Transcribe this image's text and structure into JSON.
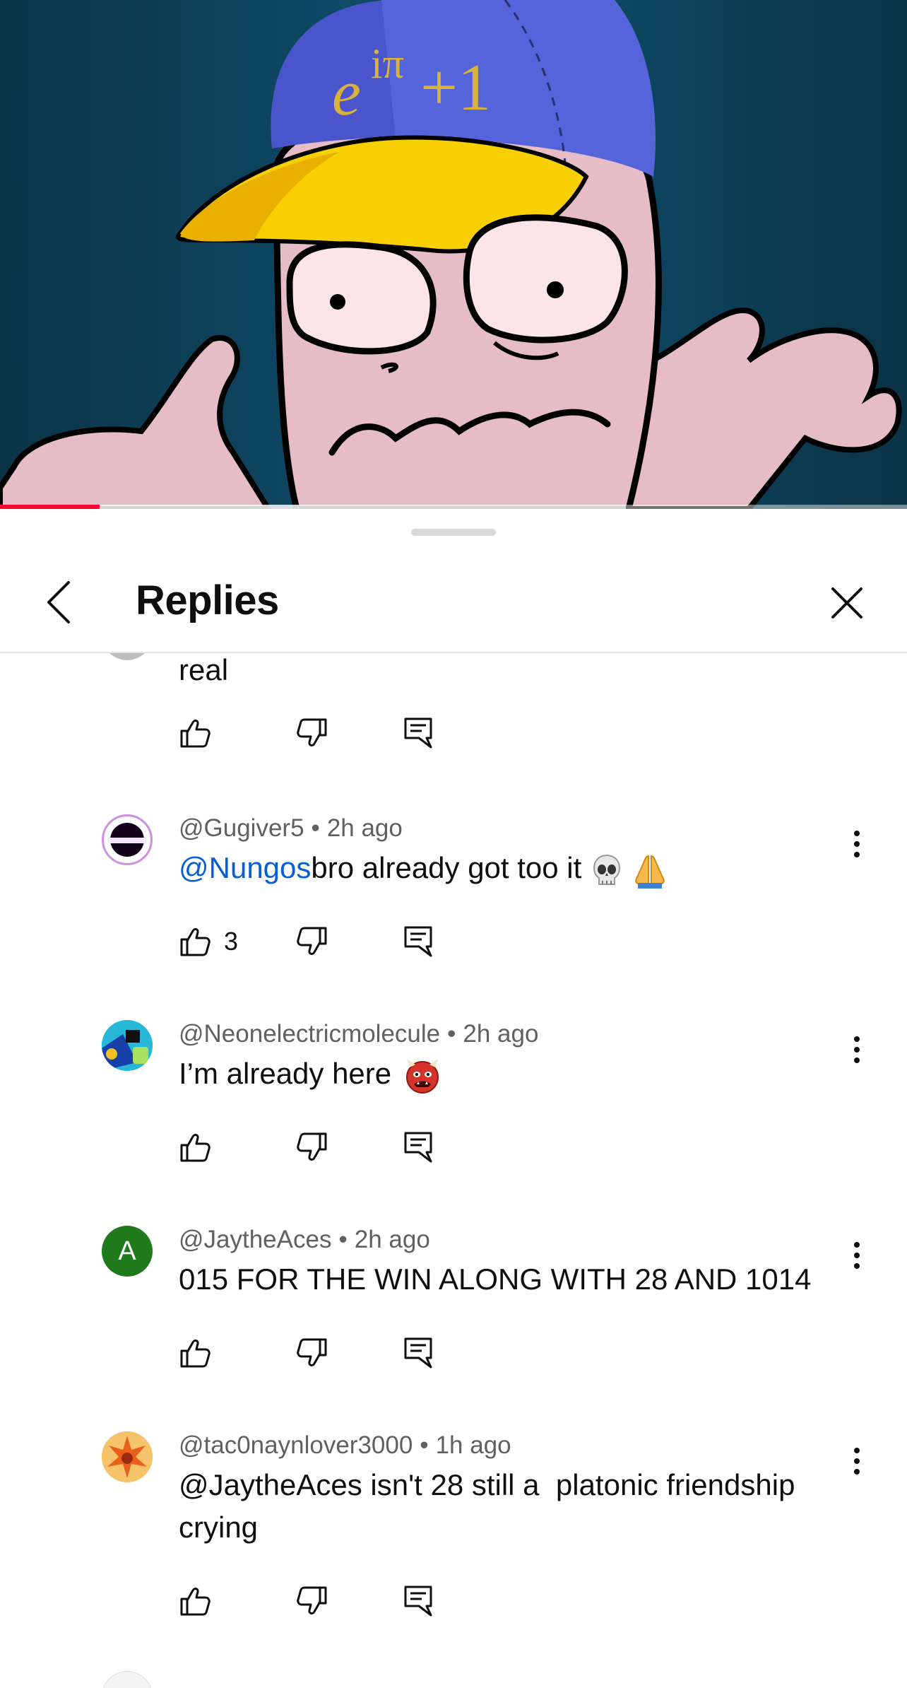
{
  "video": {
    "cap_text": "e^{iπ}+1",
    "cap_text_main": "e",
    "cap_text_sup": "iπ",
    "cap_text_tail": "+1",
    "progress_played": 0.11,
    "progress_buffered": 0.69,
    "colors": {
      "played": "#ff0033",
      "bg": "#0a3a50"
    }
  },
  "header": {
    "title": "Replies",
    "back_icon": "chevron-left-icon",
    "close_icon": "close-icon"
  },
  "comments": [
    {
      "author": "",
      "time": "",
      "text": "real",
      "likes": ""
    },
    {
      "author": "@Gugiver5",
      "time": "2h ago",
      "mention": "@Nungos",
      "text": "bro already got too it",
      "emojis": [
        "skull-emoji",
        "folded-hands-emoji"
      ],
      "likes": "3"
    },
    {
      "author": "@Neonelectricmolecule",
      "time": "2h ago",
      "text": "I’m already here",
      "emojis": [
        "ogre-emoji"
      ],
      "likes": ""
    },
    {
      "author": "@JaytheAces",
      "time": "2h ago",
      "avatar_letter": "A",
      "text": "015 FOR THE WIN ALONG WITH 28 AND 1014",
      "likes": ""
    },
    {
      "author": "@tac0naynlover3000",
      "time": "1h ago",
      "text": "@JaytheAces isn't 28 still a  platonic friendship crying",
      "likes": ""
    }
  ],
  "separator": "•"
}
